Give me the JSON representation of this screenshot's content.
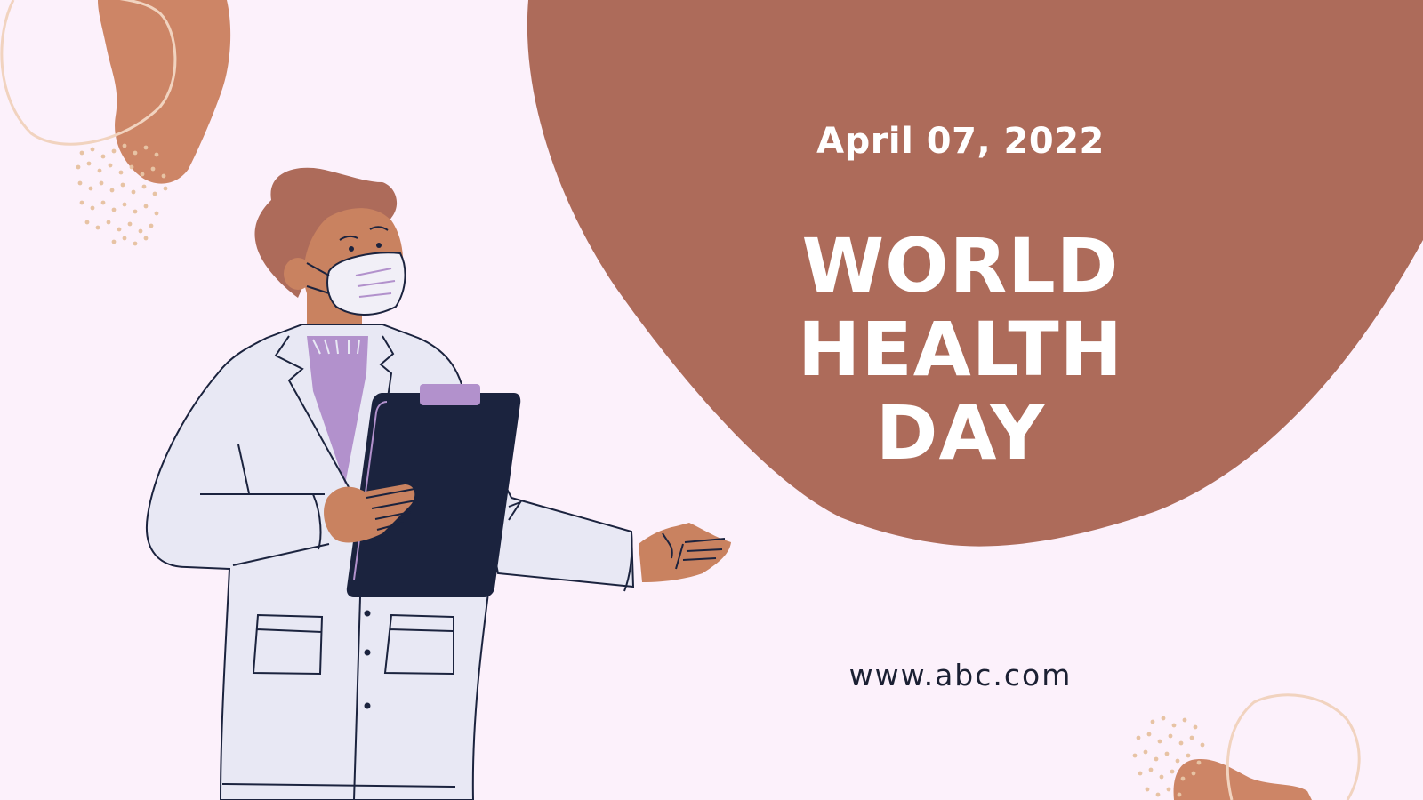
{
  "date": "April 07, 2022",
  "title_lines": [
    "WORLD",
    "HEALTH",
    "DAY"
  ],
  "website": "www.abc.com",
  "colors": {
    "background": "#fcf1fb",
    "blob_brown": "#ad6b5a",
    "accent_orange": "#cd8566",
    "coat": "#e8e8f4",
    "clipboard": "#1b233e",
    "sweater": "#b291cc",
    "skin": "#c98260",
    "hair": "#ad6b5a",
    "text_dark": "#1b2033"
  },
  "icons": [
    "doctor-illustration",
    "clipboard-icon",
    "face-mask-icon"
  ]
}
